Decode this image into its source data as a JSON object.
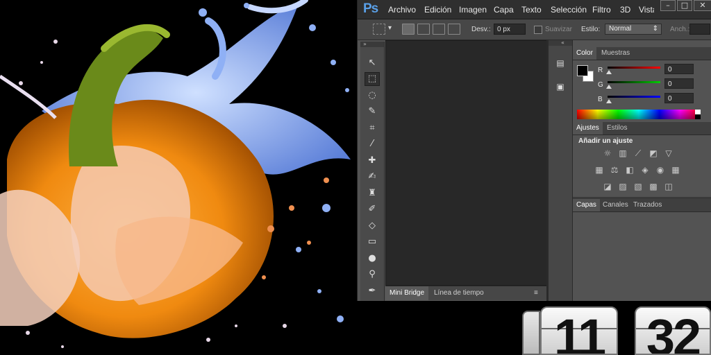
{
  "app": {
    "logo": "Ps",
    "menu": [
      "Archivo",
      "Edición",
      "Imagen",
      "Capa",
      "Texto",
      "Selección",
      "Filtro",
      "3D",
      "Vista"
    ],
    "window_buttons": [
      "–",
      "□"
    ]
  },
  "options_bar": {
    "feather_label": "Desv.:",
    "feather_value": "0 px",
    "smooth_label": "Suavizar",
    "style_label": "Estilo:",
    "style_value": "Normal",
    "width_label": "Anch.:"
  },
  "tools": [
    {
      "name": "move-tool",
      "icon": "↖"
    },
    {
      "name": "marquee-tool",
      "icon": "⬚",
      "selected": true
    },
    {
      "name": "lasso-tool",
      "icon": "◌"
    },
    {
      "name": "quick-selection-tool",
      "icon": "✎"
    },
    {
      "name": "crop-tool",
      "icon": "⌗"
    },
    {
      "name": "eyedropper-tool",
      "icon": "⁄"
    },
    {
      "name": "healing-brush-tool",
      "icon": "✚"
    },
    {
      "name": "brush-tool",
      "icon": "✍"
    },
    {
      "name": "clone-stamp-tool",
      "icon": "♜"
    },
    {
      "name": "history-brush-tool",
      "icon": "✐"
    },
    {
      "name": "eraser-tool",
      "icon": "◇"
    },
    {
      "name": "gradient-tool",
      "icon": "▭"
    },
    {
      "name": "blur-tool",
      "icon": "●"
    },
    {
      "name": "dodge-tool",
      "icon": "⚲"
    },
    {
      "name": "pen-tool",
      "icon": "✒"
    }
  ],
  "bottom_tabs": [
    "Mini Bridge",
    "Línea de tiempo"
  ],
  "color_panel": {
    "tabs": [
      "Color",
      "Muestras"
    ],
    "channels": [
      {
        "label": "R",
        "value": "0",
        "color": "#ff0000"
      },
      {
        "label": "G",
        "value": "0",
        "color": "#00cc00"
      },
      {
        "label": "B",
        "value": "0",
        "color": "#0000ff"
      }
    ]
  },
  "adjustments_panel": {
    "tabs": [
      "Ajustes",
      "Estilos"
    ],
    "heading": "Añadir un ajuste",
    "icons": [
      [
        "brightness-icon",
        "levels-icon",
        "curves-icon",
        "exposure-icon",
        "vibrance-icon"
      ],
      [
        "hue-saturation-icon",
        "color-balance-icon",
        "black-white-icon",
        "photo-filter-icon",
        "channel-mixer-icon",
        "color-lookup-icon"
      ],
      [
        "invert-icon",
        "posterize-icon",
        "threshold-icon",
        "gradient-map-icon",
        "selective-color-icon"
      ]
    ],
    "glyphs": [
      [
        "☼",
        "▥",
        "⟋",
        "◩",
        "▽"
      ],
      [
        "▦",
        "⚖",
        "◧",
        "◈",
        "◉",
        "▦"
      ],
      [
        "◪",
        "▨",
        "▧",
        "▩",
        "◫"
      ]
    ]
  },
  "layers_panel": {
    "tabs": [
      "Capas",
      "Canales",
      "Trazados"
    ]
  },
  "clock": {
    "hours": "11",
    "minutes": "32"
  }
}
